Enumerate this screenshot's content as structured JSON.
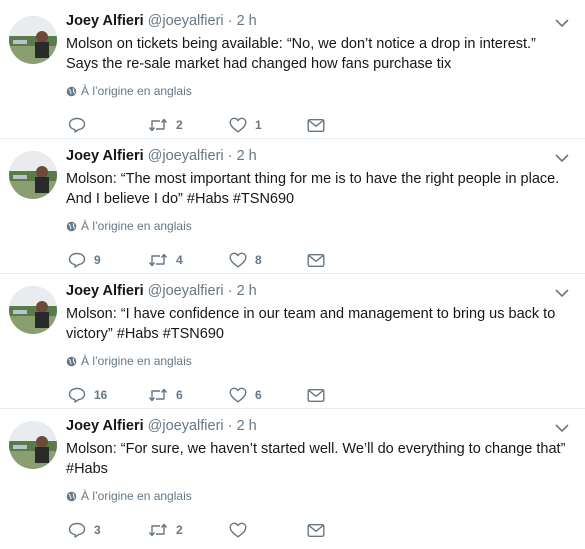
{
  "tweets": [
    {
      "name": "Joey Alfieri",
      "handle": "@joeyalfieri",
      "dot": "·",
      "time": "2 h",
      "text": "Molson on tickets being available: “No, we don’t notice a drop in interest.” Says the re-sale market had changed how fans purchase tix",
      "translation_note": "À l’origine en anglais",
      "replies": "",
      "retweets": "2",
      "likes": "1"
    },
    {
      "name": "Joey Alfieri",
      "handle": "@joeyalfieri",
      "dot": "·",
      "time": "2 h",
      "text": "Molson: “The most important thing for me is to have the right people in place. And I believe I do” #Habs #TSN690",
      "translation_note": "À l’origine en anglais",
      "replies": "9",
      "retweets": "4",
      "likes": "8"
    },
    {
      "name": "Joey Alfieri",
      "handle": "@joeyalfieri",
      "dot": "·",
      "time": "2 h",
      "text": "Molson: “I have confidence in our team and management to bring us back to victory” #Habs #TSN690",
      "translation_note": "À l’origine en anglais",
      "replies": "16",
      "retweets": "6",
      "likes": "6"
    },
    {
      "name": "Joey Alfieri",
      "handle": "@joeyalfieri",
      "dot": "·",
      "time": "2 h",
      "text": "Molson: “For sure, we haven’t started well. We’ll do everything to change that” #Habs",
      "translation_note": "À l’origine en anglais",
      "replies": "3",
      "retweets": "2",
      "likes": ""
    }
  ],
  "icons": {
    "reply": "reply-icon",
    "retweet": "retweet-icon",
    "like": "heart-icon",
    "dm": "envelope-icon",
    "globe": "globe-icon",
    "caret": "chevron-down-icon"
  },
  "colors": {
    "text": "#14171a",
    "secondary": "#657786",
    "divider": "#e6ecf0"
  }
}
